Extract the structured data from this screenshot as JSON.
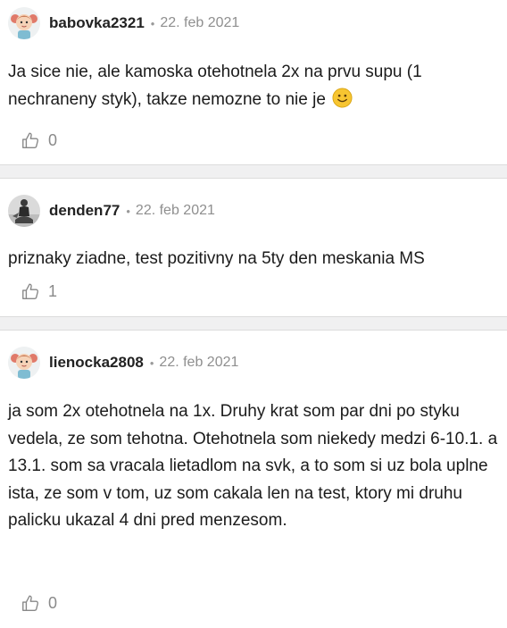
{
  "posts": [
    {
      "username": "babovka2321",
      "date": "22. feb 2021",
      "text": "Ja sice nie, ale kamoska otehotnela 2x na prvu supu (1 nechraneny styk), takze nemozne to nie je",
      "emoji": "smiley-emoji",
      "likes": "0"
    },
    {
      "username": "denden77",
      "date": "22. feb 2021",
      "text": "priznaky ziadne, test pozitivny na 5ty den meskania MS",
      "likes": "1"
    },
    {
      "username": "lienocka2808",
      "date": "22. feb 2021",
      "text": "ja som 2x otehotnela na 1x. Druhy krat som par dni po styku vedela, ze som tehotna. Otehotnela som niekedy medzi 6-10.1. a 13.1. som sa vracala lietadlom na svk, a to som si uz bola uplne ista, ze som v tom, uz som cakala len na test, ktory mi druhu palicku ukazal 4 dni pred menzesom.",
      "likes": "0"
    }
  ],
  "separator_dot": "•",
  "icons": {
    "like": "thumbs-up-icon",
    "avatar_girl": "girl-avatar-icon",
    "avatar_photo": "user-photo-avatar"
  },
  "colors": {
    "separator": "#f0f0f1",
    "meta": "#8f8f8f",
    "emoji": "#f7c531"
  }
}
